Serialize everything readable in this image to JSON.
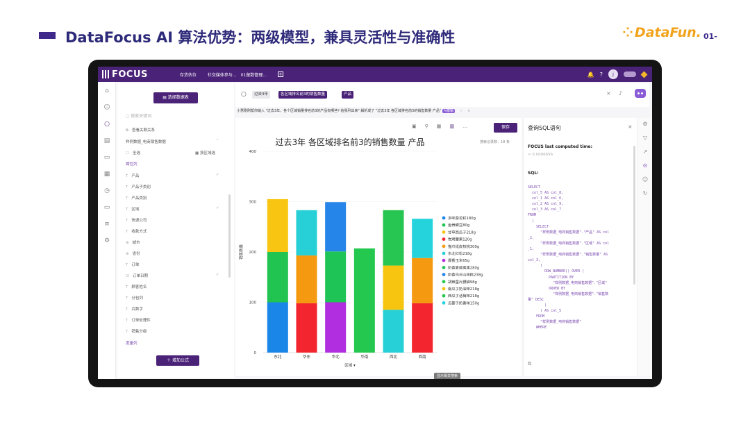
{
  "slide": {
    "title": "DataFocus AI 算法优势：两级模型，兼具灵活性与准确性",
    "brand": "DataFun.",
    "page_number": "01-"
  },
  "app": {
    "logo": "FOCUS",
    "nav": [
      "存货估位",
      "社交媒体参与...",
      "01留数管理..."
    ],
    "user_initial": "j"
  },
  "data_panel": {
    "select_button": "选择数据表",
    "search_placeholder": "搜索关键词",
    "view_relations": "查看关联关系",
    "table_name": "样例数据_电商销售数据",
    "select_all": "全选",
    "select_fields": "按区域选",
    "attribute_group": "属性列",
    "fields": [
      "产品",
      "产品子类别",
      "产品类别",
      "区域",
      "快递公司",
      "收款方式",
      "城市",
      "省份",
      "订单",
      "订单日期",
      "顾客姓名",
      "分包列",
      "兵数字",
      "订单处理件",
      "销售分级"
    ],
    "measure_group": "度量列",
    "add_formula": "增加公式"
  },
  "query": {
    "chips": [
      "过去3年",
      "各区域排名前3的销售数量",
      "产品"
    ],
    "hint": "小慧刚刚帮你输入 \"过去3年，各个区域销量排名前3的产品有哪些? 给我列出来\" 解析成了 \"过去3年 各区域排名前3的销售数量 产品\"",
    "hint_tag": "✎撤销"
  },
  "chart": {
    "save_label": "保存",
    "records": "搜索记录数：18 条",
    "tooltip_tag": "显示相关搜索"
  },
  "chart_data": {
    "type": "bar",
    "stacked": true,
    "title": "过去3年 各区域排名前3的销售数量 产品",
    "xlabel": "区域",
    "ylabel": "销售数量",
    "ylim": [
      0,
      400
    ],
    "yticks": [
      0,
      100,
      200,
      300,
      400
    ],
    "categories": [
      "东北",
      "华东",
      "华北",
      "华南",
      "西北",
      "西南"
    ],
    "legend_position": "right",
    "series": [
      {
        "name": "多味葵花籽180g",
        "color": "#1a86e8",
        "values": [
          100,
          0,
          0,
          0,
          0,
          0
        ]
      },
      {
        "name": "鱼骨鲫豆80g",
        "color": "#21c451",
        "values": [
          100,
          0,
          0,
          0,
          0,
          0
        ]
      },
      {
        "name": "甘草西瓜子218g",
        "color": "#f9c513",
        "values": [
          105,
          0,
          0,
          0,
          0,
          0
        ]
      },
      {
        "name": "炭烤腰果120g",
        "color": "#f3252e",
        "values": [
          0,
          98,
          0,
          0,
          0,
          98
        ]
      },
      {
        "name": "猫爪纸皮核桃300g",
        "color": "#f59a10",
        "values": [
          0,
          95,
          0,
          0,
          0,
          90
        ]
      },
      {
        "name": "东北红松218g",
        "color": "#27d0d6",
        "values": [
          0,
          90,
          0,
          0,
          85,
          0
        ]
      },
      {
        "name": "爆香玉米65g",
        "color": "#b12ee0",
        "values": [
          0,
          0,
          100,
          0,
          0,
          0
        ]
      },
      {
        "name": "奶香夏威夷果280g",
        "color": "#1fc457",
        "values": [
          0,
          0,
          101,
          0,
          0,
          0
        ]
      },
      {
        "name": "奶香乌日山核桃238g",
        "color": "#2585e8",
        "values": [
          0,
          0,
          98,
          0,
          0,
          0
        ]
      },
      {
        "name": "胡辣蚕片腰鳞98g",
        "color": "#24c84f",
        "values": [
          0,
          0,
          0,
          207,
          0,
          0
        ]
      },
      {
        "name": "南瓜子奶油味218g",
        "color": "#f7c510",
        "values": [
          0,
          0,
          0,
          0,
          88,
          0
        ]
      },
      {
        "name": "西瓜子话梅味218g",
        "color": "#27c552",
        "values": [
          0,
          0,
          0,
          0,
          110,
          0
        ]
      },
      {
        "name": "瓜蒌子奶香味150g",
        "color": "#25d3dc",
        "values": [
          0,
          0,
          0,
          0,
          0,
          78
        ]
      }
    ]
  },
  "sql_panel": {
    "title": "查询SQL语句",
    "computed_label": "FOCUS last computed time:",
    "computed_value": "≈ 0.0006656",
    "sql_label": "SQL:",
    "code": "SELECT\n  col_5 AS col_8,\n  col_1 AS col_6,\n  col_2 AS col_9,\n  col_3 AS col_7\nFROM\n  (\n    SELECT\n      \"样例数据_电商销售数据\".\"产品\" AS col\n_2,\n      \"样例数据_电商销售数据\".\"区域\" AS col\n_1,\n      \"样例数据_电商销售数据\".\"销售数量\" AS\ncol_3,\n      (\n        ROW_NUMBER() OVER (\n          PARTITION BY\n            \"样例数据_电商销售数据\".\"区域\"\n          ORDER BY\n            \"样例数据_电商销售数据\".\"销售数\n量\" DESC\n        )\n      ) AS col_5\n    FROM\n      \"样例数据_电商销售数据\"\n    WHERE"
  }
}
